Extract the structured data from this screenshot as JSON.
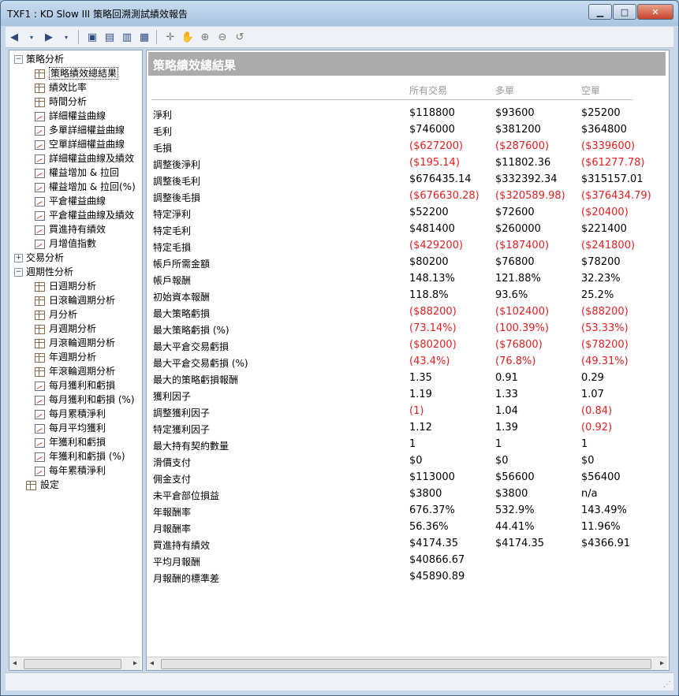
{
  "window": {
    "title": "TXF1 : KD Slow III 策略回溯測試績效報告"
  },
  "window_buttons": {
    "minimize": "▁",
    "maximize": "□",
    "close": "✕"
  },
  "toolbar_icons": [
    "back-arrow-icon",
    "dropdown-icon",
    "forward-arrow-icon",
    "dropdown-icon",
    "save-icon",
    "export-icon",
    "print-icon",
    "view-icon",
    "crosshair-icon",
    "hand-icon",
    "zoom-in-icon",
    "zoom-out-icon",
    "reset-icon"
  ],
  "tree": {
    "nodes": [
      {
        "label": "策略分析",
        "level": 0,
        "exp": "−",
        "icon": ""
      },
      {
        "label": "策略績效總結果",
        "level": 1,
        "icon": "grid",
        "selected": true
      },
      {
        "label": "績效比率",
        "level": 1,
        "icon": "grid"
      },
      {
        "label": "時間分析",
        "level": 1,
        "icon": "grid"
      },
      {
        "label": "詳細權益曲線",
        "level": 1,
        "icon": "chart"
      },
      {
        "label": "多單詳細權益曲線",
        "level": 1,
        "icon": "chart"
      },
      {
        "label": "空單詳細權益曲線",
        "level": 1,
        "icon": "chart"
      },
      {
        "label": "詳細權益曲線及績效",
        "level": 1,
        "icon": "chart"
      },
      {
        "label": "權益增加 & 拉回",
        "level": 1,
        "icon": "chart"
      },
      {
        "label": "權益增加 & 拉回(%)",
        "level": 1,
        "icon": "chart"
      },
      {
        "label": "平倉權益曲線",
        "level": 1,
        "icon": "chart"
      },
      {
        "label": "平倉權益曲線及績效",
        "level": 1,
        "icon": "chart"
      },
      {
        "label": "買進持有績效",
        "level": 1,
        "icon": "chart"
      },
      {
        "label": "月增值指數",
        "level": 1,
        "icon": "chart"
      },
      {
        "label": "交易分析",
        "level": 0,
        "exp": "+",
        "icon": ""
      },
      {
        "label": "週期性分析",
        "level": 0,
        "exp": "−",
        "icon": ""
      },
      {
        "label": "日週期分析",
        "level": 1,
        "icon": "grid"
      },
      {
        "label": "日滾輪週期分析",
        "level": 1,
        "icon": "grid"
      },
      {
        "label": "月分析",
        "level": 1,
        "icon": "grid"
      },
      {
        "label": "月週期分析",
        "level": 1,
        "icon": "grid"
      },
      {
        "label": "月滾輪週期分析",
        "level": 1,
        "icon": "grid"
      },
      {
        "label": "年週期分析",
        "level": 1,
        "icon": "grid"
      },
      {
        "label": "年滾輪週期分析",
        "level": 1,
        "icon": "grid"
      },
      {
        "label": "每月獲利和虧損",
        "level": 1,
        "icon": "chart"
      },
      {
        "label": "每月獲利和虧損 (%)",
        "level": 1,
        "icon": "chart"
      },
      {
        "label": "每月累積淨利",
        "level": 1,
        "icon": "chart"
      },
      {
        "label": "每月平均獲利",
        "level": 1,
        "icon": "chart"
      },
      {
        "label": "年獲利和虧損",
        "level": 1,
        "icon": "chart"
      },
      {
        "label": "年獲利和虧損 (%)",
        "level": 1,
        "icon": "chart"
      },
      {
        "label": "每年累積淨利",
        "level": 1,
        "icon": "chart"
      },
      {
        "label": "設定",
        "level": 0,
        "exp": "",
        "icon": "grid"
      }
    ]
  },
  "report": {
    "title": "策略績效總結果",
    "columns": [
      "所有交易",
      "多單",
      "空單"
    ],
    "rows": [
      {
        "label": "淨利",
        "values": [
          "$118800",
          "$93600",
          "$25200"
        ],
        "neg": [
          false,
          false,
          false
        ]
      },
      {
        "label": "毛利",
        "values": [
          "$746000",
          "$381200",
          "$364800"
        ],
        "neg": [
          false,
          false,
          false
        ]
      },
      {
        "label": "毛損",
        "values": [
          "($627200)",
          "($287600)",
          "($339600)"
        ],
        "neg": [
          true,
          true,
          true
        ]
      },
      {
        "label": "調整後淨利",
        "values": [
          "($195.14)",
          "$11802.36",
          "($61277.78)"
        ],
        "neg": [
          true,
          false,
          true
        ]
      },
      {
        "label": "調整後毛利",
        "values": [
          "$676435.14",
          "$332392.34",
          "$315157.01"
        ],
        "neg": [
          false,
          false,
          false
        ]
      },
      {
        "label": "調整後毛損",
        "values": [
          "($676630.28)",
          "($320589.98)",
          "($376434.79)"
        ],
        "neg": [
          true,
          true,
          true
        ]
      },
      {
        "label": "特定淨利",
        "values": [
          "$52200",
          "$72600",
          "($20400)"
        ],
        "neg": [
          false,
          false,
          true
        ]
      },
      {
        "label": "特定毛利",
        "values": [
          "$481400",
          "$260000",
          "$221400"
        ],
        "neg": [
          false,
          false,
          false
        ]
      },
      {
        "label": "特定毛損",
        "values": [
          "($429200)",
          "($187400)",
          "($241800)"
        ],
        "neg": [
          true,
          true,
          true
        ]
      },
      {
        "label": "帳戶所需金額",
        "values": [
          "$80200",
          "$76800",
          "$78200"
        ],
        "neg": [
          false,
          false,
          false
        ]
      },
      {
        "label": "帳戶報酬",
        "values": [
          "148.13%",
          "121.88%",
          "32.23%"
        ],
        "neg": [
          false,
          false,
          false
        ]
      },
      {
        "label": "初始資本報酬",
        "values": [
          "118.8%",
          "93.6%",
          "25.2%"
        ],
        "neg": [
          false,
          false,
          false
        ]
      },
      {
        "label": "最大策略虧損",
        "values": [
          "($88200)",
          "($102400)",
          "($88200)"
        ],
        "neg": [
          true,
          true,
          true
        ]
      },
      {
        "label": "最大策略虧損 (%)",
        "values": [
          "(73.14%)",
          "(100.39%)",
          "(53.33%)"
        ],
        "neg": [
          true,
          true,
          true
        ]
      },
      {
        "label": "最大平倉交易虧損",
        "values": [
          "($80200)",
          "($76800)",
          "($78200)"
        ],
        "neg": [
          true,
          true,
          true
        ]
      },
      {
        "label": "最大平倉交易虧損 (%)",
        "values": [
          "(43.4%)",
          "(76.8%)",
          "(49.31%)"
        ],
        "neg": [
          true,
          true,
          true
        ]
      },
      {
        "label": "最大的策略虧損報酬",
        "values": [
          "1.35",
          "0.91",
          "0.29"
        ],
        "neg": [
          false,
          false,
          false
        ]
      },
      {
        "label": "獲利因子",
        "values": [
          "1.19",
          "1.33",
          "1.07"
        ],
        "neg": [
          false,
          false,
          false
        ]
      },
      {
        "label": "調整獲利因子",
        "values": [
          "(1)",
          "1.04",
          "(0.84)"
        ],
        "neg": [
          true,
          false,
          true
        ]
      },
      {
        "label": "特定獲利因子",
        "values": [
          "1.12",
          "1.39",
          "(0.92)"
        ],
        "neg": [
          false,
          false,
          true
        ]
      },
      {
        "label": "最大持有契約數量",
        "values": [
          "1",
          "1",
          "1"
        ],
        "neg": [
          false,
          false,
          false
        ]
      },
      {
        "label": "滑價支付",
        "values": [
          "$0",
          "$0",
          "$0"
        ],
        "neg": [
          false,
          false,
          false
        ]
      },
      {
        "label": "佣金支付",
        "values": [
          "$113000",
          "$56600",
          "$56400"
        ],
        "neg": [
          false,
          false,
          false
        ]
      },
      {
        "label": "未平倉部位損益",
        "values": [
          "$3800",
          "$3800",
          "n/a"
        ],
        "neg": [
          false,
          false,
          false
        ]
      },
      {
        "label": "年報酬率",
        "values": [
          "676.37%",
          "532.9%",
          "143.49%"
        ],
        "neg": [
          false,
          false,
          false
        ]
      },
      {
        "label": "月報酬率",
        "values": [
          "56.36%",
          "44.41%",
          "11.96%"
        ],
        "neg": [
          false,
          false,
          false
        ]
      },
      {
        "label": "買進持有績效",
        "values": [
          "$4174.35",
          "$4174.35",
          "$4366.91"
        ],
        "neg": [
          false,
          false,
          false
        ]
      },
      {
        "label": "平均月報酬",
        "values": [
          "$40866.67",
          "",
          ""
        ],
        "neg": [
          false,
          false,
          false
        ]
      },
      {
        "label": "月報酬的標準差",
        "values": [
          "$45890.89",
          "",
          ""
        ],
        "neg": [
          false,
          false,
          false
        ]
      }
    ]
  },
  "scroll": {
    "left": "◂",
    "right": "▸"
  }
}
